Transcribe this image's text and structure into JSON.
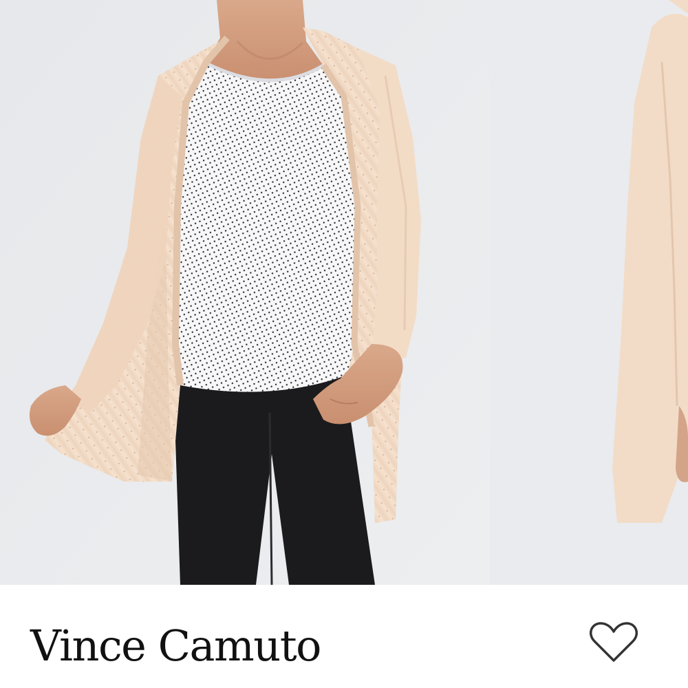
{
  "product": {
    "brand": "Vince Camuto"
  },
  "actions": {
    "like_icon": "heart-outline-icon"
  },
  "colors": {
    "background": "#e9ebee",
    "cardigan": "#f2dcc7",
    "pants": "#1b1b1d",
    "text": "#111111"
  }
}
